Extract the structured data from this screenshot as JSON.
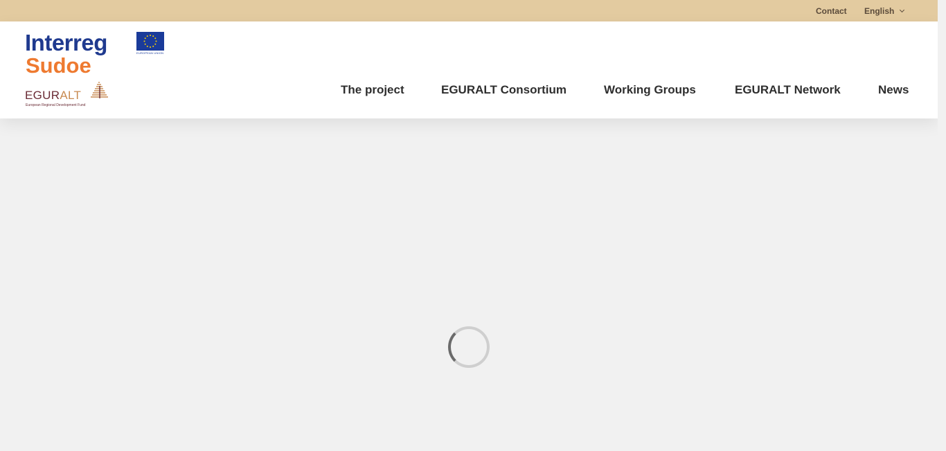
{
  "topbar": {
    "contact_label": "Contact",
    "language_label": "English"
  },
  "logo": {
    "interreg": "Interreg",
    "sudoe": "Sudoe",
    "eu_caption": "EUROPEAN UNION",
    "egur": "EGUR",
    "alt": "ALT",
    "fund": "European Regional Development Fund"
  },
  "nav": {
    "items": [
      {
        "label": "The project"
      },
      {
        "label": "EGURALT Consortium"
      },
      {
        "label": "Working Groups"
      },
      {
        "label": "EGURALT Network"
      },
      {
        "label": "News"
      }
    ]
  },
  "colors": {
    "topbar_bg": "#e3cba0",
    "interreg_blue": "#1f3a8f",
    "sudoe_orange": "#ee7a30",
    "egur_maroon": "#6a2b35",
    "alt_tan": "#c88a50",
    "page_bg": "#f1f1f1"
  },
  "icons": {
    "eu_flag": "eu-flag-icon",
    "building": "building-icon",
    "language_chevron": "chevron-down-icon",
    "loading": "loading-spinner-icon"
  }
}
